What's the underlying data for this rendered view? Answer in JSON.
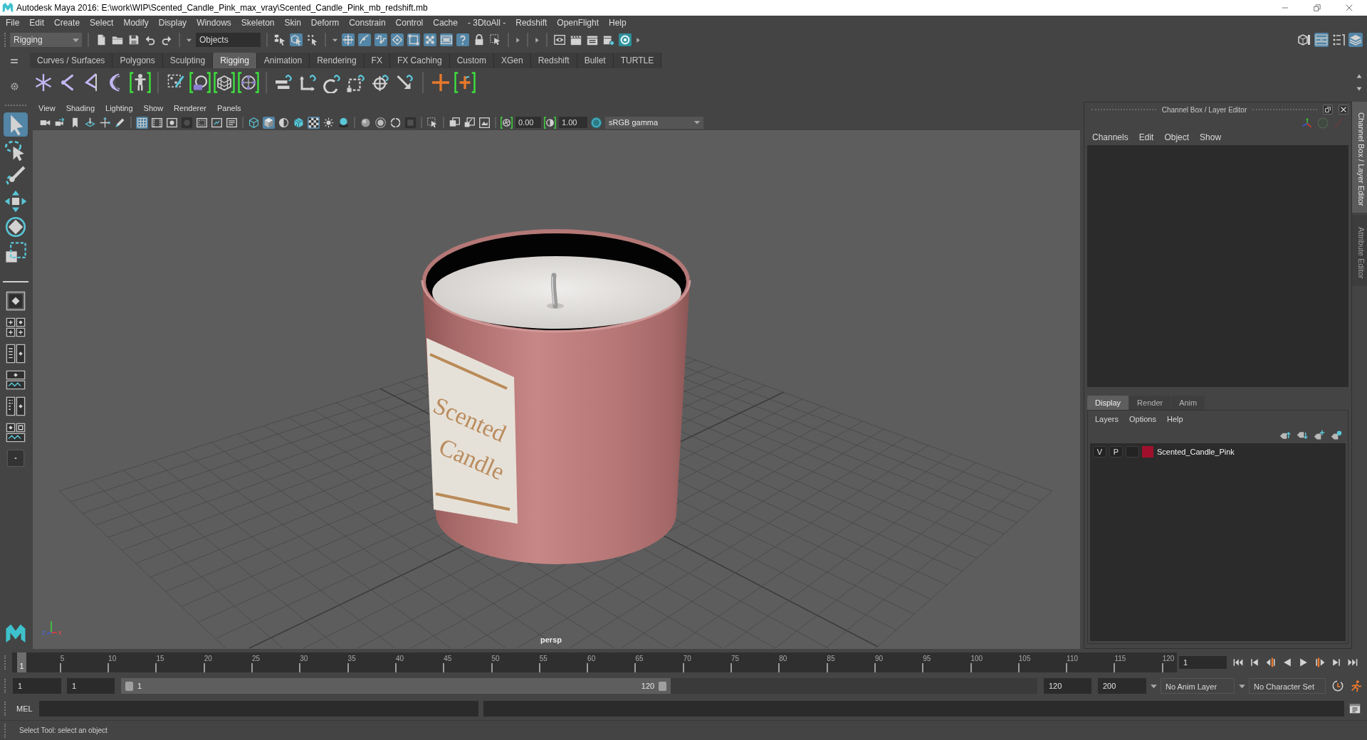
{
  "window": {
    "title": "Autodesk Maya 2016: E:\\work\\WIP\\Scented_Candle_Pink_max_vray\\Scented_Candle_Pink_mb_redshift.mb"
  },
  "menu_bar": [
    "File",
    "Edit",
    "Create",
    "Select",
    "Modify",
    "Display",
    "Windows",
    "Skeleton",
    "Skin",
    "Deform",
    "Constrain",
    "Control",
    "Cache",
    "- 3DtoAll -",
    "Redshift",
    "OpenFlight",
    "Help"
  ],
  "status_line": {
    "menu_set": "Rigging",
    "selection_mode": "Objects",
    "select_modes": [
      {
        "selected": false
      },
      {
        "selected": true
      },
      {
        "selected": false
      }
    ],
    "snap_toggles": [
      {
        "on": true
      },
      {
        "on": true
      },
      {
        "on": true
      },
      {
        "on": true
      },
      {
        "on": true
      },
      {
        "on": true
      },
      {
        "on": true
      },
      {
        "on": true
      }
    ],
    "panel_toggles": [
      {
        "on": false
      },
      {
        "on": true
      },
      {
        "on": false
      },
      {
        "on": true
      }
    ]
  },
  "shelf": {
    "tabs": [
      {
        "label": "Curves / Surfaces",
        "selected": false
      },
      {
        "label": "Polygons",
        "selected": false
      },
      {
        "label": "Sculpting",
        "selected": false
      },
      {
        "label": "Rigging",
        "selected": true
      },
      {
        "label": "Animation",
        "selected": false
      },
      {
        "label": "Rendering",
        "selected": false
      },
      {
        "label": "FX",
        "selected": false
      },
      {
        "label": "FX Caching",
        "selected": false
      },
      {
        "label": "Custom",
        "selected": false
      },
      {
        "label": "XGen",
        "selected": false
      },
      {
        "label": "Redshift",
        "selected": false
      },
      {
        "label": "Bullet",
        "selected": false
      },
      {
        "label": "TURTLE",
        "selected": false
      }
    ]
  },
  "toolbox": {
    "tools": [
      {
        "selected": true
      },
      {
        "selected": false
      },
      {
        "selected": false
      },
      {
        "selected": false
      },
      {
        "selected": false
      },
      {
        "selected": false
      }
    ]
  },
  "viewport": {
    "menu": [
      "View",
      "Shading",
      "Lighting",
      "Show",
      "Renderer",
      "Panels"
    ],
    "toolbar": [
      {
        "on": false
      },
      {
        "on": false
      },
      {
        "on": false
      },
      {
        "on": false
      },
      {
        "on": false
      },
      {
        "on": false
      },
      {
        "on": true
      },
      {
        "on": false
      },
      {
        "on": false
      },
      {
        "on": false
      },
      {
        "on": false
      },
      {
        "on": false
      },
      {
        "on": false
      },
      {
        "on": false
      },
      {
        "on": true
      },
      {
        "on": false
      },
      {
        "on": false
      },
      {
        "on": true
      },
      {
        "on": false
      },
      {
        "on": false
      },
      {
        "on": false
      },
      {
        "on": false
      },
      {
        "on": false
      },
      {
        "on": false
      },
      {
        "on": false
      },
      {
        "on": false
      },
      {
        "on": false
      },
      {
        "on": false
      },
      {
        "on": false
      },
      {
        "on": false
      },
      {
        "on": false
      }
    ],
    "exposure": "0.00",
    "gamma": "1.00",
    "color_space": "sRGB gamma",
    "candle_label": [
      "Scented",
      "Candle"
    ],
    "axis_labels": [
      "z",
      "x"
    ],
    "camera": "persp"
  },
  "channel_box": {
    "title": "Channel Box / Layer Editor",
    "menu": [
      "Channels",
      "Edit",
      "Object",
      "Show"
    ]
  },
  "layer_editor": {
    "tabs": [
      {
        "label": "Display",
        "selected": true
      },
      {
        "label": "Render",
        "selected": false
      },
      {
        "label": "Anim",
        "selected": false
      }
    ],
    "menu": [
      "Layers",
      "Options",
      "Help"
    ],
    "layers": [
      {
        "visibility": "V",
        "playback": "P",
        "name": "Scented_Candle_Pink",
        "color": "#a0102c"
      }
    ]
  },
  "side_tabs": [
    {
      "label": "Channel Box / Layer Editor",
      "selected": true
    },
    {
      "label": "Attribute Editor",
      "selected": false
    }
  ],
  "time_slider": {
    "ticks": [
      "5",
      "10",
      "15",
      "20",
      "25",
      "30",
      "35",
      "40",
      "45",
      "50",
      "55",
      "60",
      "65",
      "70",
      "75",
      "80",
      "85",
      "90",
      "95",
      "100",
      "105",
      "110",
      "115",
      "120"
    ],
    "current_frame_marker": "1",
    "level": 0,
    "current_frame": "1"
  },
  "range_slider": {
    "start_time": "1",
    "playback_start": "1",
    "range_start": "1",
    "range_end": "120",
    "level": 0.6,
    "playback_end": "120",
    "end_time": "200",
    "anim_layer": "No Anim Layer",
    "character_set": "No Character Set"
  },
  "command_line": {
    "language": "MEL"
  },
  "help_line": "Select Tool: select an object"
}
